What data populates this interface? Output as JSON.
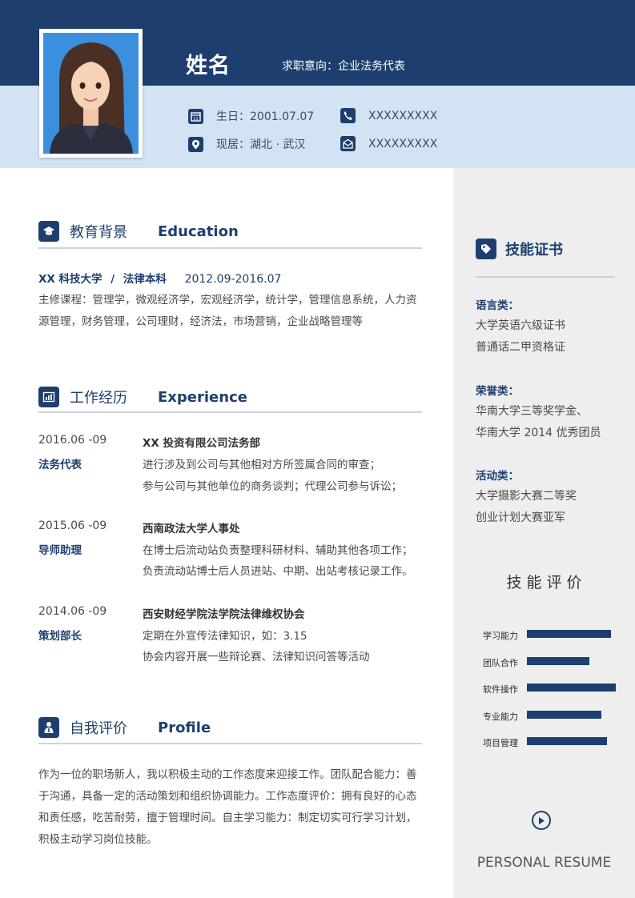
{
  "header": {
    "name": "姓名",
    "intent": "求职意向：企业法务代表",
    "birthday": "生日：2001.07.07",
    "phone": "XXXXXXXXX",
    "residence": "现居：湖北 · 武汉",
    "email": "XXXXXXXXX"
  },
  "education": {
    "title_cn": "教育背景",
    "title_en": "Education",
    "school": "XX 科技大学",
    "sep": "/",
    "major": "法律本科",
    "period": "2012.09-2016.07",
    "courses_line1": "主修课程：管理学，微观经济学，宏观经济学，统计学，管理信息系统，人力资",
    "courses_line2": "源管理，财务管理，公司理财，经济法，市场营销，企业战略管理等"
  },
  "work": {
    "title_cn": "工作经历",
    "title_en": "Experience",
    "items": [
      {
        "date": "2016.06 -09",
        "role": "法务代表",
        "org": "XX 投资有限公司法务部",
        "line1": "进行涉及到公司与其他相对方所签属合同的审查；",
        "line2": "参与公司与其他单位的商务谈判；代理公司参与诉讼；"
      },
      {
        "date": "2015.06 -09",
        "role": "导师助理",
        "org": "西南政法大学人事处",
        "line1": "在博士后流动站负责整理科研材料、辅助其他各项工作；",
        "line2": "负责流动站博士后人员进站、中期、出站考核记录工作。"
      },
      {
        "date": "2014.06 -09",
        "role": "策划部长",
        "org": "西安财经学院法学院法律维权协会",
        "line1": "定期在外宣传法律知识，如：3.15",
        "line2": "协会内容开展一些辩论赛、法律知识问答等活动"
      }
    ]
  },
  "profile": {
    "title_cn": "自我评价",
    "title_en": "Profile",
    "line1": "作为一位的职场新人，我以积极主动的工作态度来迎接工作。团队配合能力：善",
    "line2": "于沟通，具备一定的活动策划和组织协调能力。工作态度评价：拥有良好的心态",
    "line3": "和责任感，吃苦耐劳，擅于管理时间。自主学习能力：制定切实可行学习计划，",
    "line4": "积极主动学习岗位技能。"
  },
  "certs": {
    "title": "技能证书",
    "language_head": "语言类：",
    "language_items": [
      "大学英语六级证书",
      "普通话二甲资格证"
    ],
    "honor_head": "荣誉类：",
    "honor_items": [
      "华南大学三等奖学金、",
      "华南大学 2014 优秀团员"
    ],
    "activity_head": "活动类：",
    "activity_items": [
      "大学摄影大赛二等奖",
      "创业计划大赛亚军"
    ]
  },
  "skills": {
    "title": "技 能 评 价",
    "items": [
      {
        "label": "学习能力",
        "level": 0.95
      },
      {
        "label": "团队合作",
        "level": 0.7
      },
      {
        "label": "软件操作",
        "level": 1.0
      },
      {
        "label": "专业能力",
        "level": 0.84
      },
      {
        "label": "项目管理",
        "level": 0.9
      }
    ]
  },
  "footer": {
    "resume_label": "PERSONAL RESUME"
  },
  "colors": {
    "primary": "#1e3f6e",
    "band": "#d4e3f4",
    "sidebar": "#eeeeef"
  }
}
